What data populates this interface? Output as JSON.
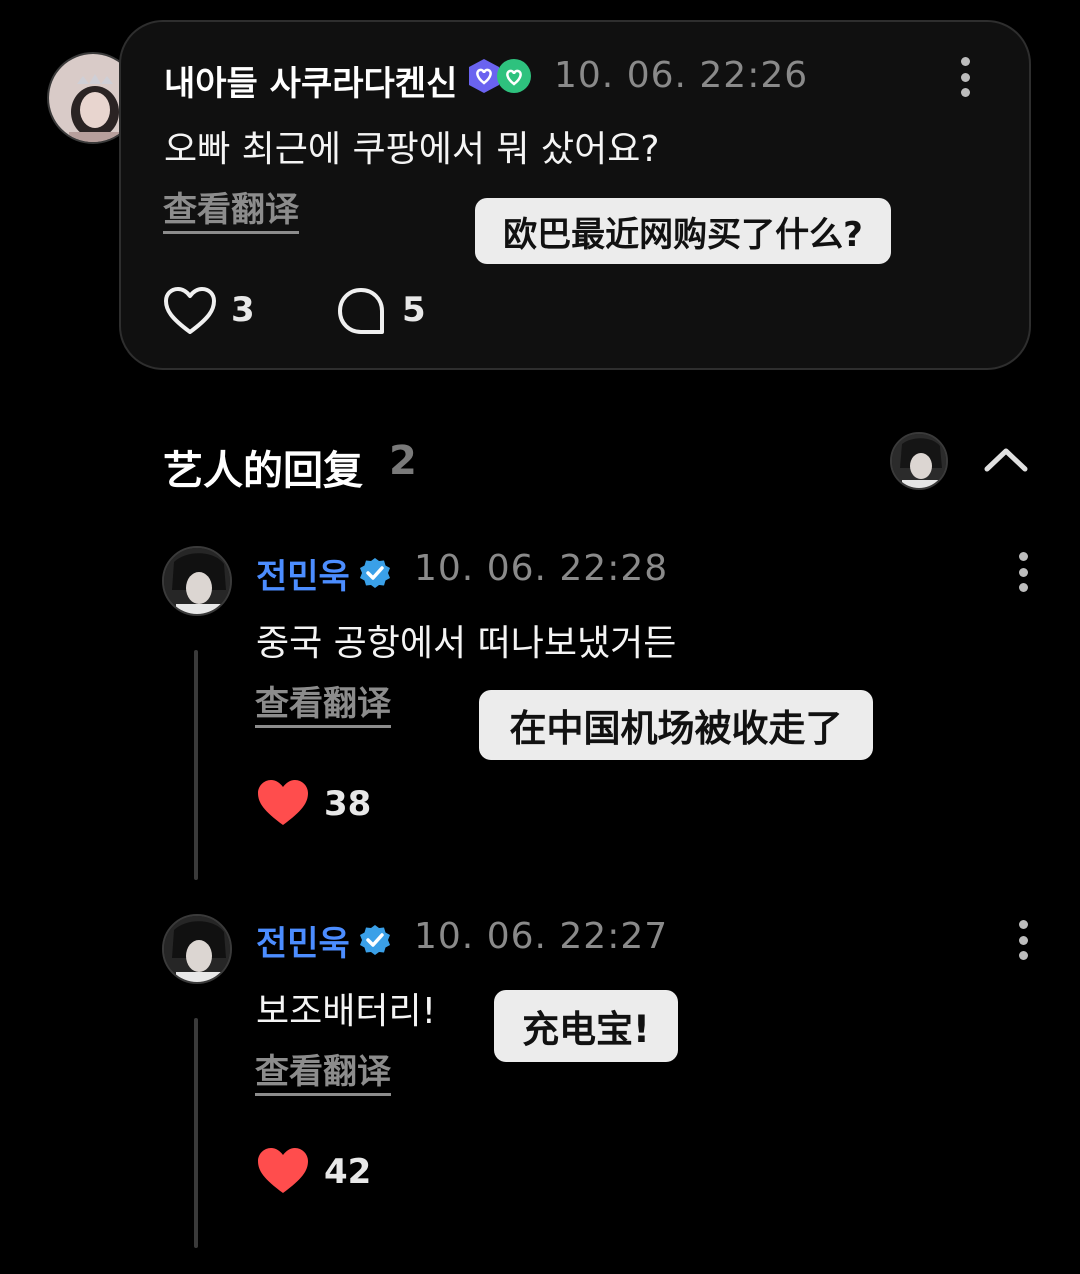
{
  "post": {
    "username": "내아들 사쿠라다켄신",
    "timestamp": "10. 06. 22:26",
    "text": "오빠 최근에 쿠팡에서 뭐 샀어요?",
    "translate_label": "查看翻译",
    "translation_overlay": "欧巴最近网购买了什么?",
    "like_count": "3",
    "comment_count": "5",
    "badge_icons": [
      "verified-heart-badge-icon",
      "verified-heart-badge-icon"
    ]
  },
  "replies_section": {
    "title": "艺人的回复",
    "count": "2"
  },
  "replies": [
    {
      "username": "전민욱",
      "timestamp": "10. 06. 22:28",
      "text": "중국 공항에서 떠나보냈거든",
      "translate_label": "查看翻译",
      "translation_overlay": "在中国机场被收走了",
      "like_count": "38"
    },
    {
      "username": "전민욱",
      "timestamp": "10. 06. 22:27",
      "text": "보조배터리!",
      "translate_label": "查看翻译",
      "translation_overlay": "充电宝!",
      "like_count": "42"
    }
  ],
  "colors": {
    "background": "#000000",
    "card": "#101010",
    "artist_name": "#4c8dff",
    "verified": "#3aa0e8",
    "like_active": "#ff4d4d",
    "badge_purple": "#6a63f0",
    "badge_green": "#2ec27e"
  }
}
